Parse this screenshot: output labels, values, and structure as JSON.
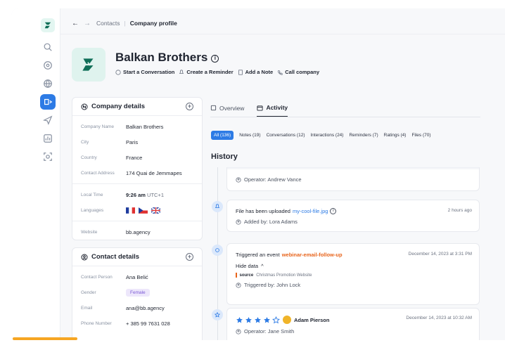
{
  "breadcrumb": {
    "back": "←",
    "forward": "→",
    "parent": "Contacts",
    "separator": "|",
    "current": "Company profile"
  },
  "company": {
    "name": "Balkan Brothers",
    "info_icon": "i",
    "actions": [
      "Start a Conversation",
      "Create a Reminder",
      "Add a Note",
      "Call company"
    ]
  },
  "company_details": {
    "title": "Company details",
    "rows": [
      {
        "key": "Company Name",
        "value": "Balkan Brothers"
      },
      {
        "key": "City",
        "value": "Paris"
      },
      {
        "key": "Country",
        "value": "France"
      },
      {
        "key": "Contact Address",
        "value": "174 Quai de Jemmapes"
      }
    ],
    "local_time": {
      "key": "Local Time",
      "value": "9:26 am",
      "tz": "UTC+1"
    },
    "languages": {
      "key": "Languages",
      "flags": [
        "fr",
        "cz",
        "gb"
      ]
    },
    "website": {
      "key": "Website",
      "value": "bb.agency"
    }
  },
  "contact_details": {
    "title": "Contact details",
    "rows": [
      {
        "key": "Contact Person",
        "value": "Ana Belić"
      },
      {
        "key": "Gender",
        "value": "Female"
      },
      {
        "key": "Email",
        "value": "ana@bb.agency"
      },
      {
        "key": "Phone Number",
        "value": "+ 385 99 7631 028"
      }
    ]
  },
  "tabs": [
    "Overview",
    "Activity"
  ],
  "filters": [
    "All (136)",
    "Notes (19)",
    "Conversations (12)",
    "Interactions (24)",
    "Reminders (7)",
    "Ratings (4)",
    "Files (70)"
  ],
  "history_label": "History",
  "activities": [
    {
      "meta": "Operator: Andrew Vance"
    },
    {
      "title": "File has been uploaded",
      "link": "my-cool-file.jpg",
      "time": "2 hours ago",
      "meta": "Added by: Lora Adams"
    },
    {
      "title": "Triggered an event",
      "link": "webinar-email-follow-up",
      "time": "December 14, 2023 at 3:31 PM",
      "toggle": "Hide data",
      "source_key": "source",
      "source_value": "Christmas Promotion Website",
      "meta": "Triggered by: John Lock"
    },
    {
      "rating": 4,
      "person": "Adam Pierson",
      "time": "December 14, 2023 at 10:32 AM",
      "meta": "Operator: Jane Smith"
    }
  ],
  "colors": {
    "accent": "#2d7be5",
    "orange": "#e8641b",
    "brand": "#0f6e57"
  }
}
